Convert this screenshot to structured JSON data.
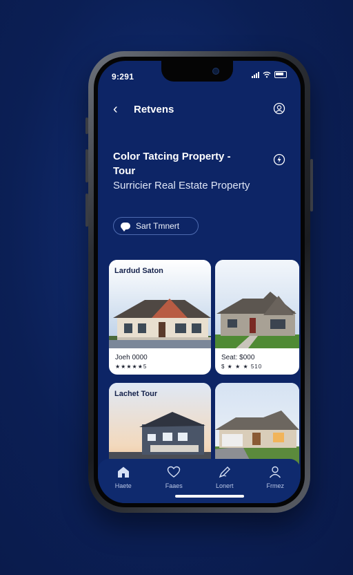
{
  "status_bar": {
    "time": "9:291"
  },
  "header": {
    "title": "Retvens"
  },
  "hero": {
    "title": "Color Tatcing Property - Tour",
    "subtitle": "Surricier Real Estate Property"
  },
  "tour_button": {
    "label": "Sart Tmnert"
  },
  "cards": [
    {
      "label": "Lardud Saton",
      "price": "Joeh 0000",
      "rating_text": "★★★★★5"
    },
    {
      "label": "",
      "price": "Seat: $000",
      "rating_text": "$ ★ ★ ★ 510"
    },
    {
      "label": "Lachet Tour",
      "price": "",
      "rating_text": ""
    },
    {
      "label": "",
      "price": "",
      "rating_text": ""
    }
  ],
  "bottom_nav": {
    "items": [
      {
        "label": "Haete",
        "icon": "home-icon"
      },
      {
        "label": "Faaes",
        "icon": "heart-icon"
      },
      {
        "label": "Lonert",
        "icon": "pen-icon"
      },
      {
        "label": "Frmez",
        "icon": "user-icon"
      }
    ]
  },
  "colors": {
    "background": "#0b1f55",
    "screen": "#0d2566",
    "nav": "#0f2a6e",
    "accent_border": "#4e6bb0"
  }
}
